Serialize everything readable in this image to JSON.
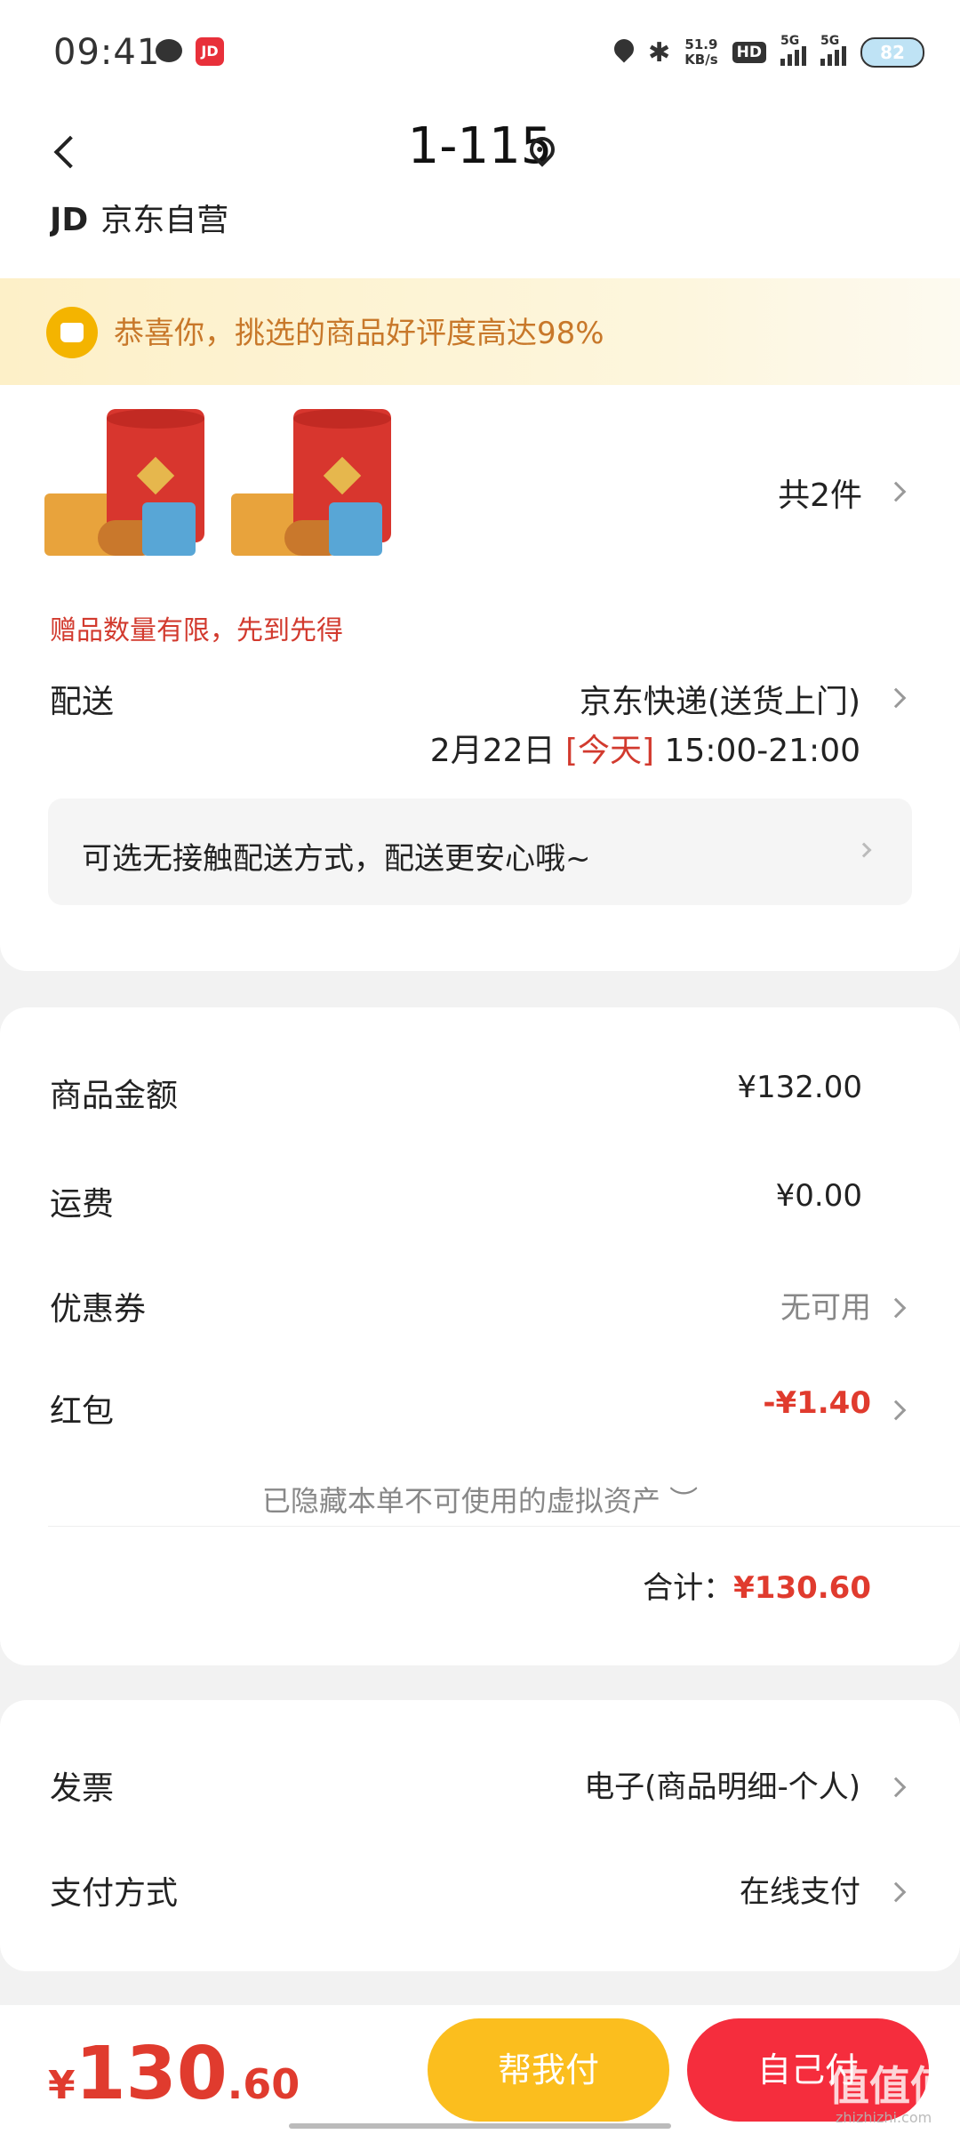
{
  "status_bar": {
    "time": "09:41",
    "app_badge": "JD",
    "net_speed_value": "51.9",
    "net_speed_unit": "KB/s",
    "hd_label": "HD",
    "sig1_label": "5G",
    "sig2_label": "5G",
    "battery": "82",
    "bluetooth": "✱"
  },
  "header": {
    "title": "1-115"
  },
  "shop": {
    "logo": "JD",
    "name": "京东自营"
  },
  "banner": {
    "text": "恭喜你，挑选的商品好评度高达98%"
  },
  "products": {
    "count_label": "共2件",
    "gift_note": "赠品数量有限，先到先得"
  },
  "delivery": {
    "label": "配送",
    "method": "京东快递(送货上门)",
    "date": "2月22日",
    "today": "[今天]",
    "time_slot": "15:00-21:00",
    "contactless": "可选无接触配送方式，配送更安心哦~"
  },
  "price_summary": {
    "goods_label": "商品金额",
    "goods_value": "¥132.00",
    "shipping_label": "运费",
    "shipping_value": "¥0.00",
    "coupon_label": "优惠券",
    "coupon_value": "无可用",
    "redpacket_label": "红包",
    "redpacket_value": "-¥1.40",
    "hidden_note": "已隐藏本单不可使用的虚拟资产 ︶",
    "total_label": "合计：",
    "total_value": "¥130.60"
  },
  "invoice": {
    "label": "发票",
    "value": "电子(商品明细-个人)",
    "pay_label": "支付方式",
    "pay_value": "在线支付"
  },
  "bottom": {
    "yen": "¥",
    "amount_int": "130",
    "amount_dec": ".60",
    "help_pay": "帮我付",
    "self_pay": "自己付",
    "watermark": "值值值",
    "watermark_sub": "zhizhizhi.com"
  },
  "colors": {
    "accent_red": "#e03b2e",
    "help_button": "#fbbe1e",
    "self_button": "#f52d3d",
    "banner_text": "#c8782a"
  }
}
